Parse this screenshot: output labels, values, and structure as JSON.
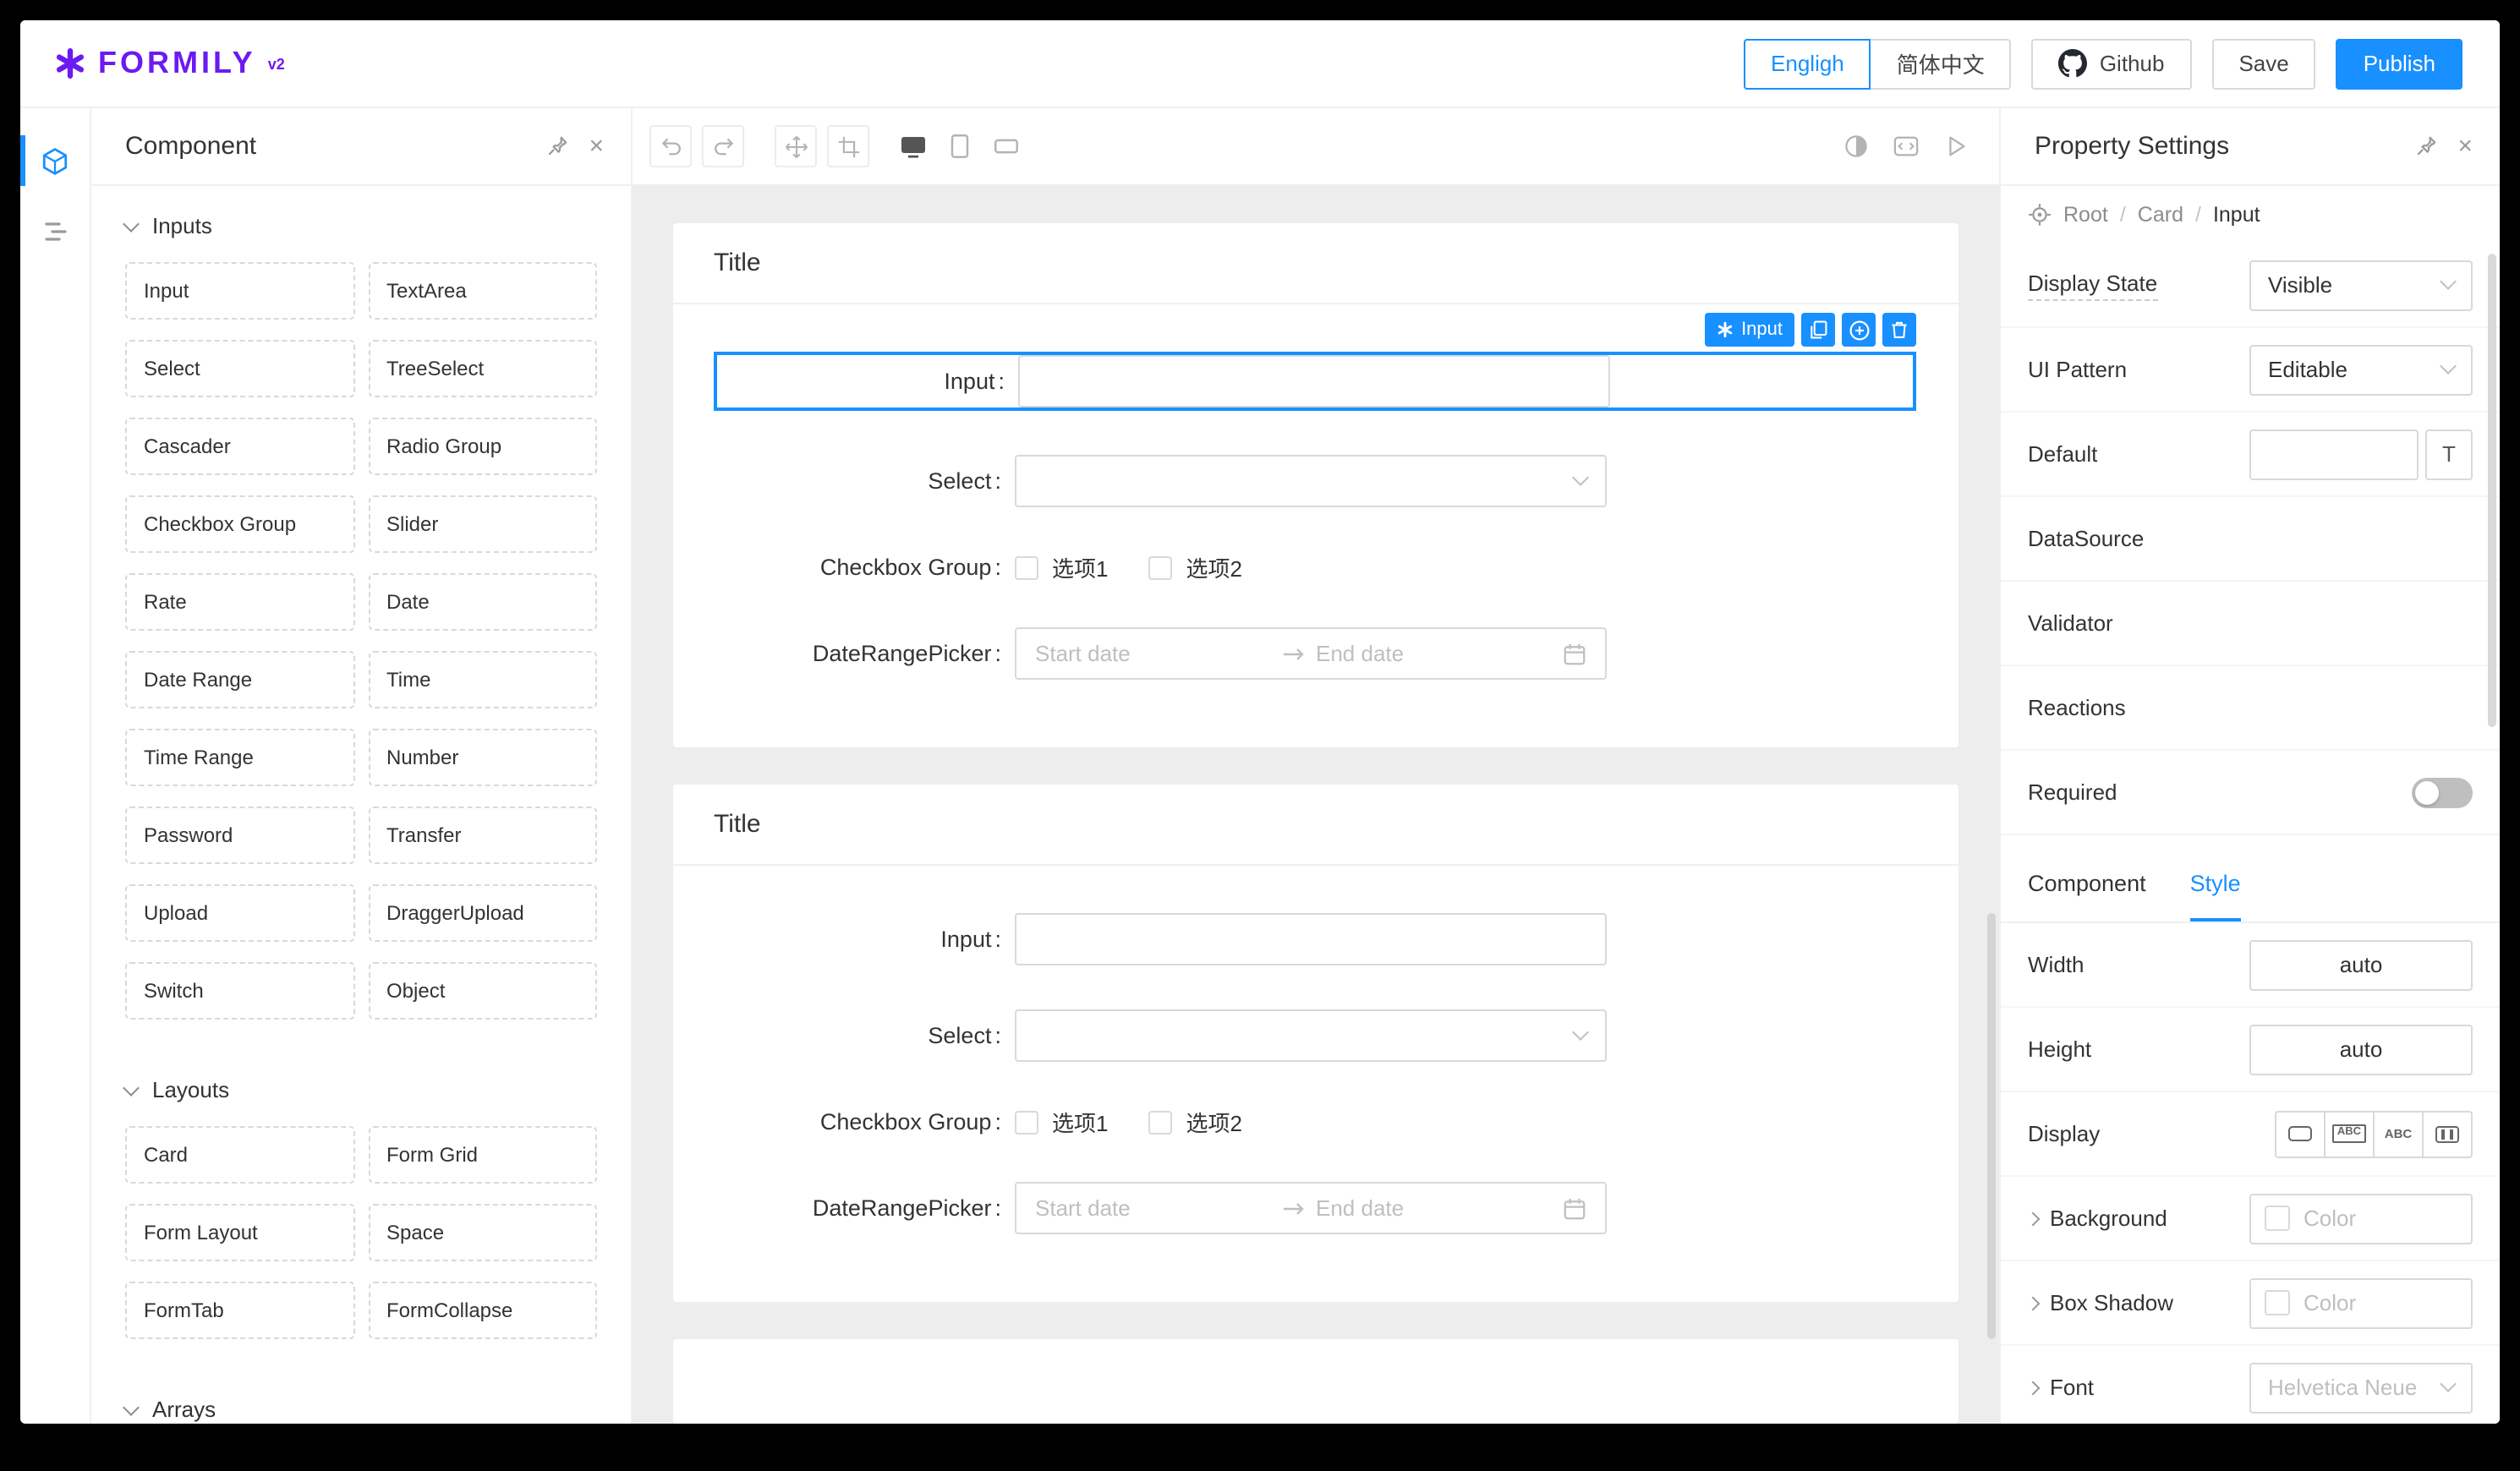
{
  "colors": {
    "accent": "#1890ff",
    "brand_purple": "#6C1AF1",
    "canvas_bg": "#ededed"
  },
  "header": {
    "logo_text": "FORMILY",
    "logo_version": "v2",
    "languages": [
      "Engligh",
      "简体中文"
    ],
    "active_language": "Engligh",
    "github_label": "Github",
    "save_label": "Save",
    "publish_label": "Publish"
  },
  "component_panel": {
    "title": "Component",
    "sections": [
      {
        "label": "Inputs",
        "items": [
          "Input",
          "TextArea",
          "Select",
          "TreeSelect",
          "Cascader",
          "Radio Group",
          "Checkbox Group",
          "Slider",
          "Rate",
          "Date",
          "Date Range",
          "Time",
          "Time Range",
          "Number",
          "Password",
          "Transfer",
          "Upload",
          "DraggerUpload",
          "Switch",
          "Object"
        ]
      },
      {
        "label": "Layouts",
        "items": [
          "Card",
          "Form Grid",
          "Form Layout",
          "Space",
          "FormTab",
          "FormCollapse"
        ]
      },
      {
        "label": "Arrays",
        "items": []
      }
    ]
  },
  "canvas": {
    "colon": ":",
    "selection_chip": "Input",
    "cards": [
      {
        "title": "Title",
        "input_label": "Input",
        "select_label": "Select",
        "checkbox_label": "Checkbox Group",
        "checkbox_options": [
          "选项1",
          "选项2"
        ],
        "daterange_label": "DateRangePicker",
        "date_start_placeholder": "Start date",
        "date_end_placeholder": "End date"
      },
      {
        "title": "Title",
        "input_label": "Input",
        "select_label": "Select",
        "checkbox_label": "Checkbox Group",
        "checkbox_options": [
          "选项1",
          "选项2"
        ],
        "daterange_label": "DateRangePicker",
        "date_start_placeholder": "Start date",
        "date_end_placeholder": "End date"
      }
    ]
  },
  "property_panel": {
    "title": "Property Settings",
    "breadcrumb": [
      "Root",
      "Card",
      "Input"
    ],
    "breadcrumb_separator": "/",
    "rows": {
      "display_state": {
        "label": "Display State",
        "value": "Visible"
      },
      "ui_pattern": {
        "label": "UI Pattern",
        "value": "Editable"
      },
      "default": {
        "label": "Default",
        "suffix": "T"
      },
      "data_source": {
        "label": "DataSource"
      },
      "validator": {
        "label": "Validator"
      },
      "reactions": {
        "label": "Reactions"
      },
      "required": {
        "label": "Required",
        "value": false
      }
    },
    "tabs": {
      "component": "Component",
      "style": "Style",
      "active": "Style"
    },
    "style_rows": {
      "width": {
        "label": "Width",
        "value": "auto"
      },
      "height": {
        "label": "Height",
        "value": "auto"
      },
      "display": {
        "label": "Display",
        "abc": "ABC"
      },
      "background": {
        "label": "Background",
        "placeholder": "Color"
      },
      "box_shadow": {
        "label": "Box Shadow",
        "placeholder": "Color"
      },
      "font": {
        "label": "Font",
        "placeholder": "Helvetica Neue"
      }
    }
  }
}
